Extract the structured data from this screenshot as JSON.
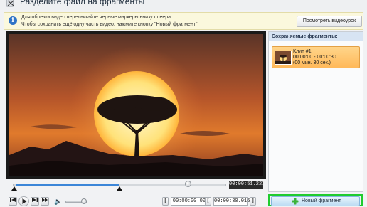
{
  "window": {
    "title": "Разделите файл на фрагменты"
  },
  "hint": {
    "line1": "Для обрезки видео передвигайте черные маркеры внизу плеера.",
    "line2": "Чтобы сохранить ещё одну часть видео, нажмите кнопку \"Новый фрагмент\".",
    "tutorial_button": "Посмотреть видеоурок"
  },
  "player": {
    "current_time": "00:00:51.227",
    "progress_fraction": 0.82,
    "selection_start_fraction": 0.0,
    "selection_end_fraction": 0.5,
    "volume_fraction": 0.85,
    "start_time": "00:00:00.000",
    "end_time": "00:00:30.016",
    "bracket_start": "[",
    "bracket_end": "]"
  },
  "fragments": {
    "header": "Сохраняемые фрагменты:",
    "items": [
      {
        "name": "Клип #1",
        "range": "00:00:00 - 00:00:30",
        "duration": "(00 мин. 30 сек.)"
      }
    ]
  },
  "actions": {
    "new_fragment": "Новый фрагмент"
  },
  "colors": {
    "accent_green": "#1fcc2f",
    "timeline_blue": "#3c86d8",
    "fragment_orange": "#ffb95a"
  },
  "icons": {
    "title": "scissors-icon",
    "hint": "info-icon",
    "add": "plus-icon"
  }
}
